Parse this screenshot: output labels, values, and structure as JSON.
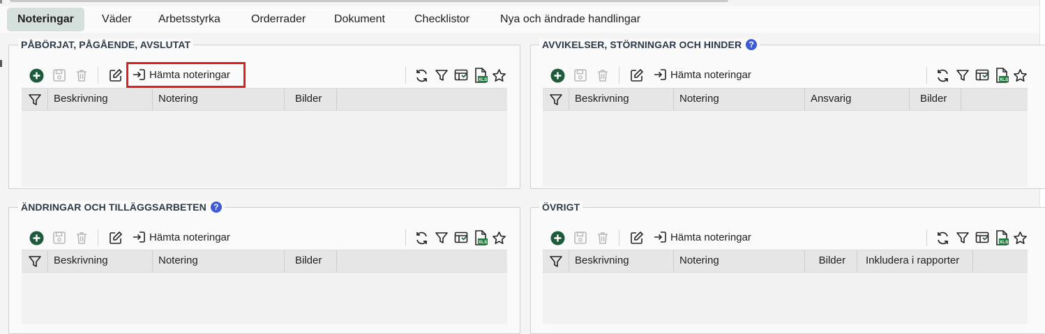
{
  "tabs": [
    {
      "label": "Noteringar",
      "active": true
    },
    {
      "label": "Väder"
    },
    {
      "label": "Arbetsstyrka"
    },
    {
      "label": "Orderrader"
    },
    {
      "label": "Dokument"
    },
    {
      "label": "Checklistor"
    },
    {
      "label": "Nya och ändrade handlingar"
    }
  ],
  "toolbar": {
    "fetch_label": "Hämta noteringar",
    "xls_label": "XLS"
  },
  "help_mark": "?",
  "panels": {
    "started": {
      "title": "PÅBÖRJAT, PÅGÅENDE, AVSLUTAT",
      "columns": [
        "Beskrivning",
        "Notering",
        "Bilder"
      ]
    },
    "deviations": {
      "title": "AVVIKELSER, STÖRNINGAR OCH HINDER",
      "columns": [
        "Beskrivning",
        "Notering",
        "Ansvarig",
        "Bilder"
      ]
    },
    "changes": {
      "title": "ÄNDRINGAR OCH TILLÄGGSARBETEN",
      "columns": [
        "Beskrivning",
        "Notering",
        "Bilder"
      ]
    },
    "other": {
      "title": "ÖVRIGT",
      "columns": [
        "Beskrivning",
        "Notering",
        "Bilder",
        "Inkludera i rapporter"
      ]
    }
  },
  "colors": {
    "accent_green": "#1e5a3c",
    "active_tab": "#d5e0dd",
    "help_blue": "#3d5bd6",
    "highlight_red": "#e11d1d"
  }
}
